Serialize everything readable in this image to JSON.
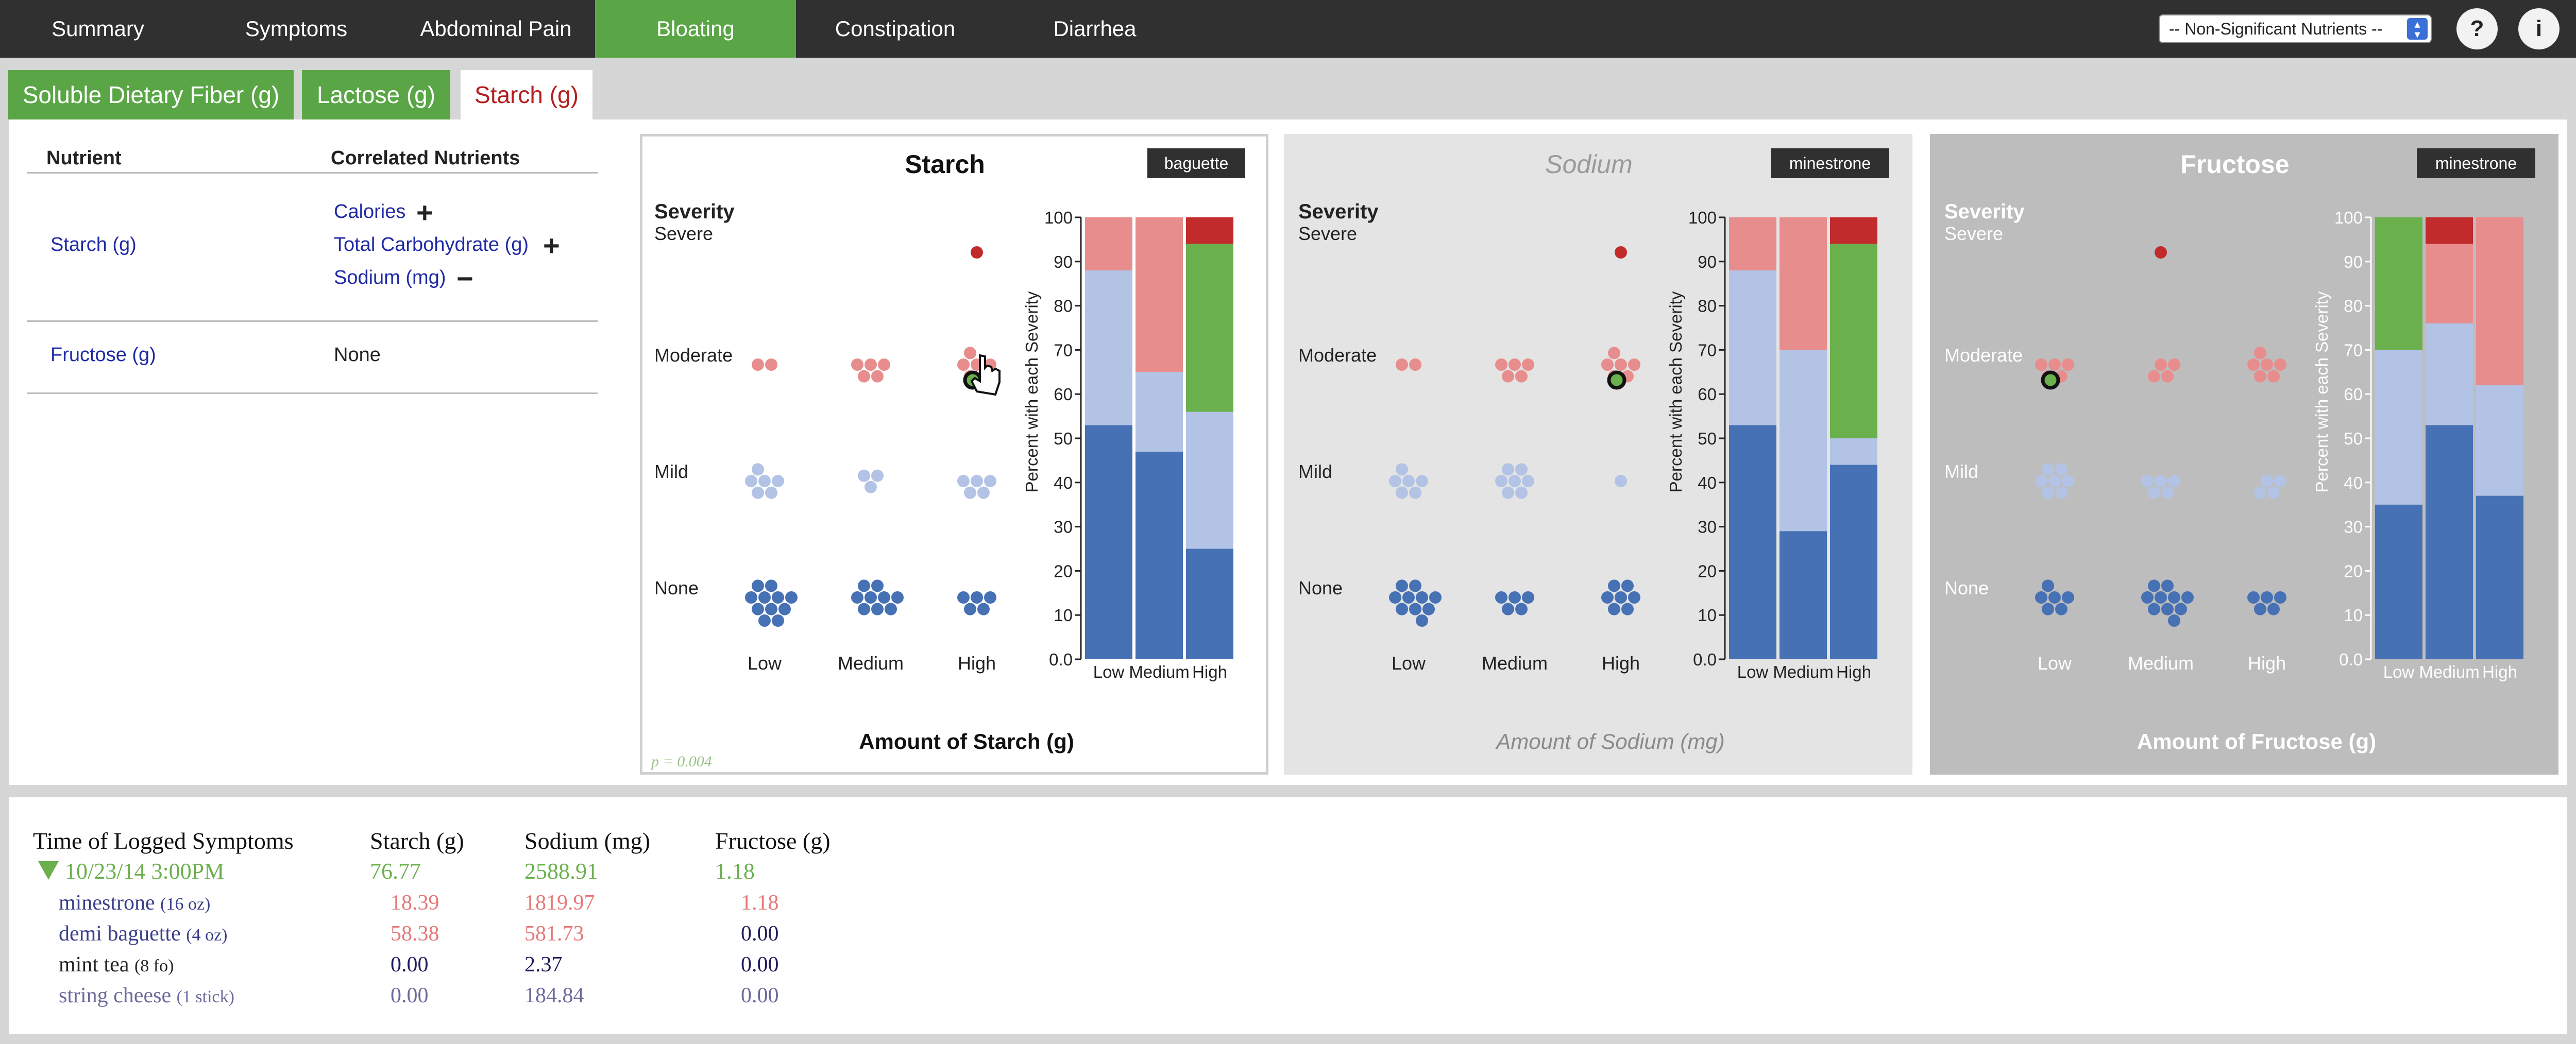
{
  "nav": {
    "tabs": [
      "Summary",
      "Symptoms",
      "Abdominal Pain",
      "Bloating",
      "Constipation",
      "Diarrhea"
    ],
    "active": "Bloating",
    "nutrient_select": "-- Non-Significant Nutrients --",
    "help": "?",
    "info": "i"
  },
  "subtabs": [
    "Soluble Dietary Fiber (g)",
    "Lactose (g)",
    "Starch (g)"
  ],
  "nutrient_table": {
    "col_nutrient": "Nutrient",
    "col_correlated": "Correlated Nutrients",
    "rows": [
      {
        "nutrient": "Starch (g)",
        "correlated": [
          {
            "name": "Calories",
            "sign": "+"
          },
          {
            "name": "Total Carbohydrate (g)",
            "sign": "+"
          },
          {
            "name": "Sodium (mg)",
            "sign": "−"
          }
        ]
      },
      {
        "nutrient": "Fructose (g)",
        "none": "None"
      }
    ]
  },
  "panels": [
    {
      "title": "Starch",
      "badge": "baguette",
      "xlabel": "Amount of Starch (g)",
      "pvalue": "p = 0.004",
      "style": "selected",
      "severity_label": "Severity",
      "severity_levels": [
        "Severe",
        "Moderate",
        "Mild",
        "None"
      ],
      "amount_levels": [
        "Low",
        "Medium",
        "High"
      ],
      "dots": {
        "Severe": [
          0,
          0,
          1
        ],
        "Moderate": [
          2,
          5,
          6
        ],
        "Mild": [
          6,
          3,
          5
        ],
        "None": [
          11,
          9,
          5
        ]
      },
      "highlight": {
        "level": "Moderate",
        "amount": "High"
      },
      "cursor": true
    },
    {
      "title": "Sodium",
      "badge": "minestrone",
      "xlabel": "Amount of Sodium (mg)",
      "pvalue": "",
      "style": "faded",
      "severity_label": "Severity",
      "severity_levels": [
        "Severe",
        "Moderate",
        "Mild",
        "None"
      ],
      "amount_levels": [
        "Low",
        "Medium",
        "High"
      ],
      "dots": {
        "Severe": [
          0,
          0,
          1
        ],
        "Moderate": [
          2,
          5,
          6
        ],
        "Mild": [
          6,
          7,
          1
        ],
        "None": [
          10,
          5,
          7
        ]
      },
      "highlight": {
        "level": "Moderate",
        "amount": "High"
      },
      "cursor": false
    },
    {
      "title": "Fructose",
      "badge": "minestrone",
      "xlabel": "Amount of Fructose (g)",
      "pvalue": "",
      "style": "dark",
      "severity_label": "Severity",
      "severity_levels": [
        "Severe",
        "Moderate",
        "Mild",
        "None"
      ],
      "amount_levels": [
        "Low",
        "Medium",
        "High"
      ],
      "dots": {
        "Severe": [
          0,
          1,
          0
        ],
        "Moderate": [
          5,
          4,
          6
        ],
        "Mild": [
          7,
          5,
          4
        ],
        "None": [
          6,
          10,
          5
        ]
      },
      "highlight": {
        "level": "Moderate",
        "amount": "Low"
      },
      "cursor": false
    }
  ],
  "colors": {
    "severe": "#c22b2b",
    "moderate": "#e88d8d",
    "mild": "#b3c3e6",
    "none": "#4671b4",
    "green": "#6ab04c",
    "link": "#1f2aa6",
    "red_value": "#e57878"
  },
  "chart_data": [
    {
      "type": "bar",
      "title": "",
      "ylabel": "Percent with each Severity",
      "categories": [
        "Low",
        "Medium",
        "High"
      ],
      "ylim": [
        0,
        100
      ],
      "yticks": [
        "100",
        "90",
        "80",
        "70",
        "60",
        "50",
        "40",
        "30",
        "20",
        "10",
        "0.0"
      ],
      "series": [
        {
          "name": "None",
          "values": [
            53,
            47,
            25
          ]
        },
        {
          "name": "Mild",
          "values": [
            35,
            18,
            31
          ]
        },
        {
          "name": "Moderate",
          "values": [
            12,
            35,
            0
          ]
        },
        {
          "name": "Highlighted",
          "values": [
            0,
            0,
            38
          ]
        },
        {
          "name": "Severe",
          "values": [
            0,
            0,
            6
          ]
        }
      ]
    },
    {
      "type": "bar",
      "title": "",
      "ylabel": "Percent with each Severity",
      "categories": [
        "Low",
        "Medium",
        "High"
      ],
      "ylim": [
        0,
        100
      ],
      "yticks": [
        "100",
        "90",
        "80",
        "70",
        "60",
        "50",
        "40",
        "30",
        "20",
        "10",
        "0.0"
      ],
      "series": [
        {
          "name": "None",
          "values": [
            53,
            29,
            44
          ]
        },
        {
          "name": "Mild",
          "values": [
            35,
            41,
            6
          ]
        },
        {
          "name": "Moderate",
          "values": [
            12,
            30,
            0
          ]
        },
        {
          "name": "Highlighted",
          "values": [
            0,
            0,
            44
          ]
        },
        {
          "name": "Severe",
          "values": [
            0,
            0,
            6
          ]
        }
      ]
    },
    {
      "type": "bar",
      "title": "",
      "ylabel": "Percent with each Severity",
      "categories": [
        "Low",
        "Medium",
        "High"
      ],
      "ylim": [
        0,
        100
      ],
      "yticks": [
        "100",
        "90",
        "80",
        "70",
        "60",
        "50",
        "40",
        "30",
        "20",
        "10",
        "0.0"
      ],
      "series": [
        {
          "name": "None",
          "values": [
            35,
            53,
            37
          ]
        },
        {
          "name": "Mild",
          "values": [
            35,
            23,
            25
          ]
        },
        {
          "name": "Moderate",
          "values": [
            0,
            18,
            38
          ]
        },
        {
          "name": "Highlighted",
          "values": [
            30,
            0,
            0
          ]
        },
        {
          "name": "Severe",
          "values": [
            0,
            6,
            0
          ]
        }
      ]
    }
  ],
  "log": {
    "headers": [
      "Time of Logged Symptoms",
      "Starch (g)",
      "Sodium (mg)",
      "Fructose (g)"
    ],
    "entry": {
      "time": "10/23/14 3:00PM",
      "values": [
        "76.77",
        "2588.91",
        "1.18"
      ]
    },
    "items": [
      {
        "name": "minestrone",
        "portion": "(16 oz)",
        "values": [
          "18.39",
          "1819.97",
          "1.18"
        ],
        "red": [
          true,
          true,
          true
        ]
      },
      {
        "name": "demi baguette",
        "portion": "(4 oz)",
        "values": [
          "58.38",
          "581.73",
          "0.00"
        ],
        "red": [
          true,
          true,
          false
        ]
      },
      {
        "name": "mint tea",
        "portion": "(8 fo)",
        "values": [
          "0.00",
          "2.37",
          "0.00"
        ],
        "red": [
          false,
          false,
          false
        ]
      },
      {
        "name": "string cheese",
        "portion": "(1 stick)",
        "values": [
          "0.00",
          "184.84",
          "0.00"
        ],
        "red": [
          false,
          false,
          false
        ]
      }
    ]
  }
}
